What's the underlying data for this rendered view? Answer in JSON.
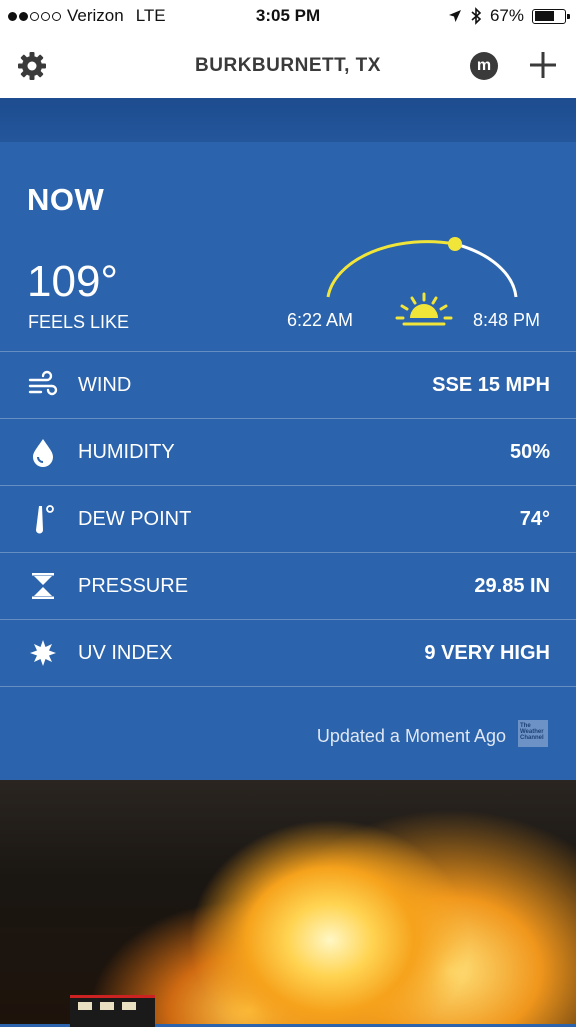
{
  "status_bar": {
    "carrier": "Verizon",
    "network": "LTE",
    "time": "3:05 PM",
    "battery": "67%",
    "battery_level": 0.67
  },
  "header": {
    "location": "BURKBURNETT, TX",
    "brand_badge": "m"
  },
  "now": {
    "heading": "NOW",
    "feels_like_temp": "109°",
    "feels_like_label": "FEELS LIKE",
    "sunrise": "6:22 AM",
    "sunset": "8:48 PM"
  },
  "conditions": [
    {
      "icon": "wind-icon",
      "label": "WIND",
      "value": "SSE 15 MPH"
    },
    {
      "icon": "humidity-drop-icon",
      "label": "HUMIDITY",
      "value": "50%"
    },
    {
      "icon": "thermometer-icon",
      "label": "DEW POINT",
      "value": "74°"
    },
    {
      "icon": "pressure-icon",
      "label": "PRESSURE",
      "value": "29.85 IN"
    },
    {
      "icon": "uv-sun-icon",
      "label": "UV INDEX",
      "value": "9 VERY HIGH"
    }
  ],
  "footer": {
    "updated_text": "Updated a Moment Ago",
    "provider_logo_text": "The Weather Channel"
  },
  "colors": {
    "panel_bg": "#2b63ac",
    "band_bg": "#1d4c8f",
    "arc_daylight": "#f2e53a",
    "arc_night": "#ffffff"
  }
}
